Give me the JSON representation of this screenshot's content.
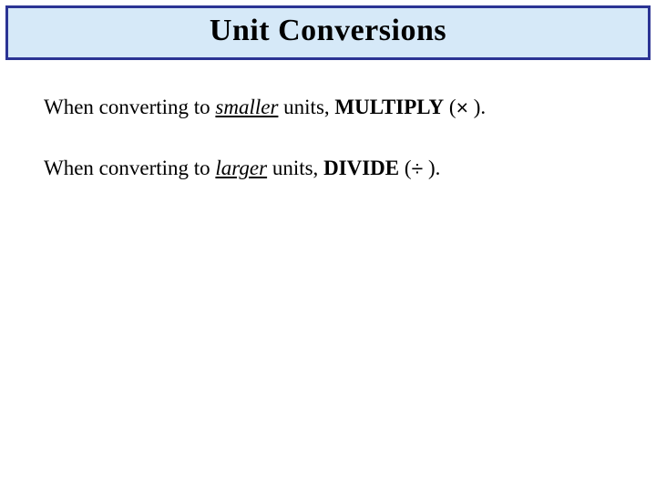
{
  "title": "Unit Conversions",
  "line1": {
    "prefix": "When converting to ",
    "emph": "smaller",
    "mid": " units, ",
    "action": "MULTIPLY",
    "open": " (",
    "symbol": "×",
    "close": " )."
  },
  "line2": {
    "prefix": "When converting to ",
    "emph": "larger",
    "mid": " units, ",
    "action": "DIVIDE",
    "open": " (",
    "symbol": "÷",
    "close": " )."
  }
}
